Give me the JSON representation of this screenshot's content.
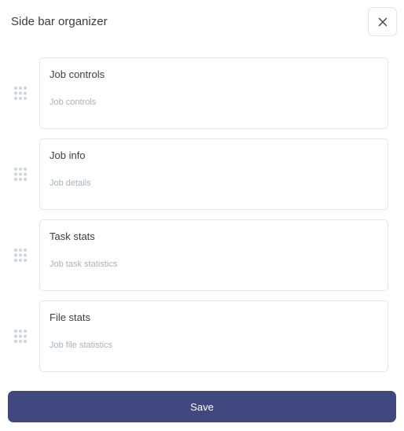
{
  "header": {
    "title": "Side bar organizer",
    "close_icon": "close-icon"
  },
  "items": [
    {
      "title": "Job controls",
      "subtitle": "Job controls",
      "handle_icon": "drag-handle-icon"
    },
    {
      "title": "Job info",
      "subtitle": "Job details",
      "handle_icon": "drag-handle-icon"
    },
    {
      "title": "Task stats",
      "subtitle": "Job task statistics",
      "handle_icon": "drag-handle-icon"
    },
    {
      "title": "File stats",
      "subtitle": "Job file statistics",
      "handle_icon": "drag-handle-icon"
    }
  ],
  "footer": {
    "save_label": "Save"
  },
  "colors": {
    "primary": "#41477f",
    "border": "#e5e6ec",
    "handle": "#d3d5dd"
  }
}
